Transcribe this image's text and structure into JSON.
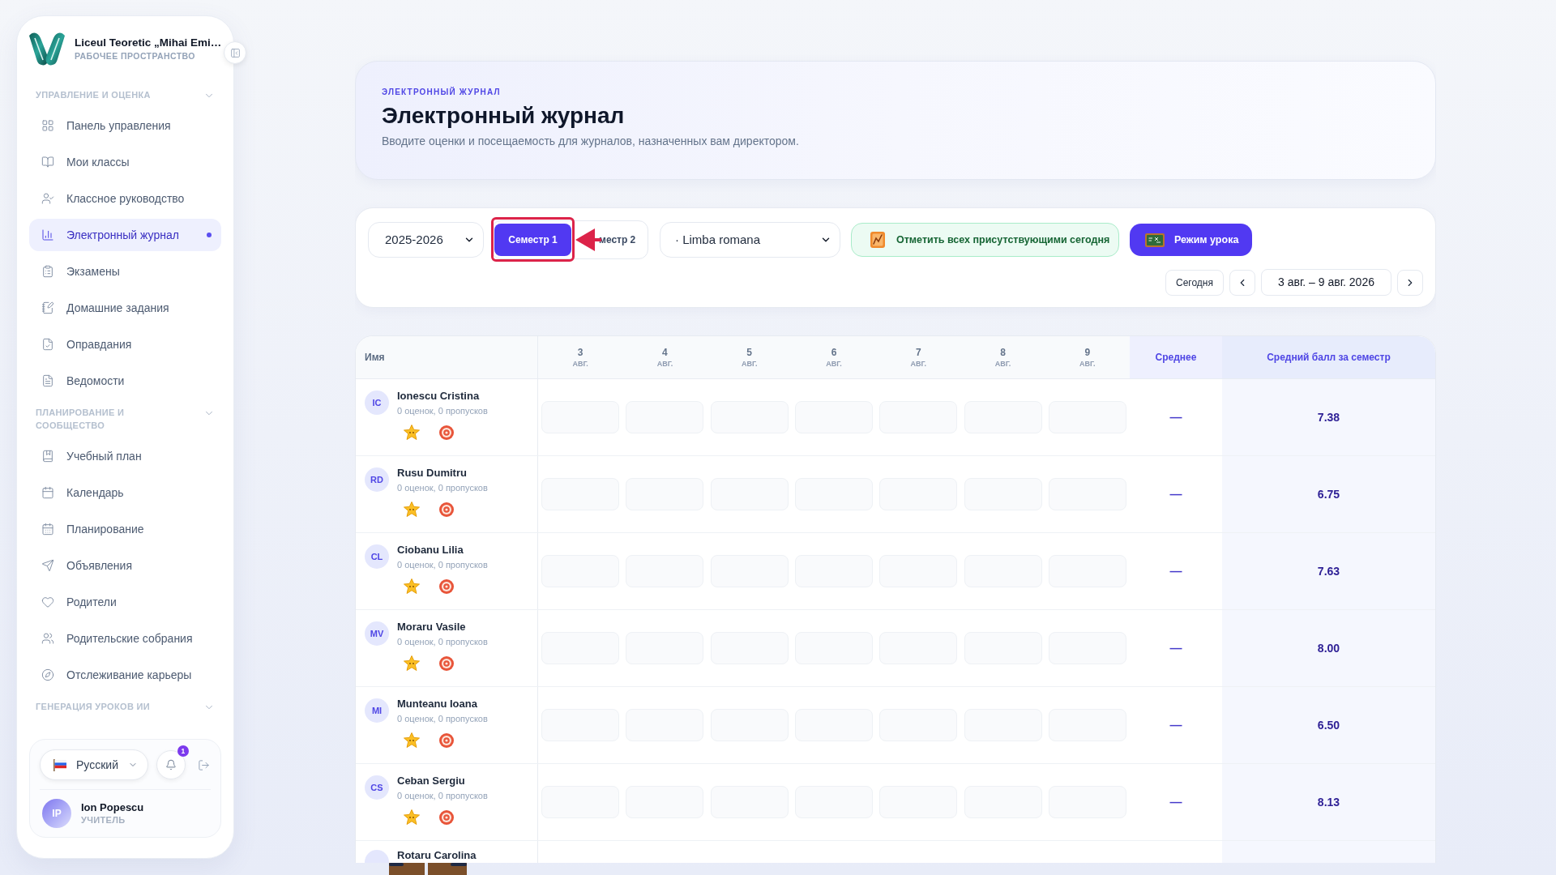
{
  "sidebar": {
    "school": "Liceul Teoretic „Mihai Emi…",
    "workspace": "РАБОЧЕЕ ПРОСТРАНСТВО",
    "sections": [
      {
        "title": "УПРАВЛЕНИЕ И ОЦЕНКА",
        "items": [
          {
            "label": "Панель управления",
            "selected": false
          },
          {
            "label": "Мои классы",
            "selected": false
          },
          {
            "label": "Классное руководство",
            "selected": false
          },
          {
            "label": "Электронный журнал",
            "selected": true
          },
          {
            "label": "Экзамены",
            "selected": false
          },
          {
            "label": "Домашние задания",
            "selected": false
          },
          {
            "label": "Оправдания",
            "selected": false
          },
          {
            "label": "Ведомости",
            "selected": false
          }
        ]
      },
      {
        "title": "ПЛАНИРОВАНИЕ И СООБЩЕСТВО",
        "items": [
          {
            "label": "Учебный план",
            "selected": false
          },
          {
            "label": "Календарь",
            "selected": false
          },
          {
            "label": "Планирование",
            "selected": false
          },
          {
            "label": "Объявления",
            "selected": false
          },
          {
            "label": "Родители",
            "selected": false
          },
          {
            "label": "Родительские собрания",
            "selected": false
          },
          {
            "label": "Отслеживание карьеры",
            "selected": false
          }
        ]
      },
      {
        "title": "ГЕНЕРАЦИЯ УРОКОВ ИИ"
      }
    ],
    "footer": {
      "language": "Русский",
      "notifications": "1",
      "user": {
        "initials": "IP",
        "name": "Ion Popescu",
        "role": "УЧИТЕЛЬ"
      }
    }
  },
  "header": {
    "eyebrow": "ЭЛЕКТРОННЫЙ ЖУРНАЛ",
    "title": "Электронный журнал",
    "subtitle": "Вводите оценки и посещаемость для журналов, назначенных вам директором."
  },
  "toolbar": {
    "year": "2025-2026",
    "semesters": [
      {
        "label": "Семестр 1",
        "selected": true
      },
      {
        "label": "местр 2",
        "selected": false
      }
    ],
    "subject": "· Limba romana",
    "mark_all": "Отметить всех присутствующими сегодня",
    "lesson_mode": "Режим урока",
    "today": "Сегодня",
    "range": "3 авг. – 9 авг. 2026"
  },
  "table": {
    "columns": {
      "name": "Имя",
      "days": [
        {
          "day": "3",
          "month": "АВГ."
        },
        {
          "day": "4",
          "month": "АВГ."
        },
        {
          "day": "5",
          "month": "АВГ."
        },
        {
          "day": "6",
          "month": "АВГ."
        },
        {
          "day": "7",
          "month": "АВГ."
        },
        {
          "day": "8",
          "month": "АВГ."
        },
        {
          "day": "9",
          "month": "АВГ."
        }
      ],
      "average": "Среднее",
      "semester_average": "Средний балл за семестр"
    },
    "rows": [
      {
        "initials": "IC",
        "name": "Ionescu Cristina",
        "summary": "0 оценок, 0 пропусков",
        "average": "—",
        "semester_average": "7.38"
      },
      {
        "initials": "RD",
        "name": "Rusu Dumitru",
        "summary": "0 оценок, 0 пропусков",
        "average": "—",
        "semester_average": "6.75"
      },
      {
        "initials": "CL",
        "name": "Ciobanu Lilia",
        "summary": "0 оценок, 0 пропусков",
        "average": "—",
        "semester_average": "7.63"
      },
      {
        "initials": "MV",
        "name": "Moraru Vasile",
        "summary": "0 оценок, 0 пропусков",
        "average": "—",
        "semester_average": "8.00"
      },
      {
        "initials": "MI",
        "name": "Munteanu Ioana",
        "summary": "0 оценок, 0 пропусков",
        "average": "—",
        "semester_average": "6.50"
      },
      {
        "initials": "CS",
        "name": "Ceban Sergiu",
        "summary": "0 оценок, 0 пропусков",
        "average": "—",
        "semester_average": "8.13"
      },
      {
        "name": "Rotaru Carolina"
      }
    ]
  }
}
